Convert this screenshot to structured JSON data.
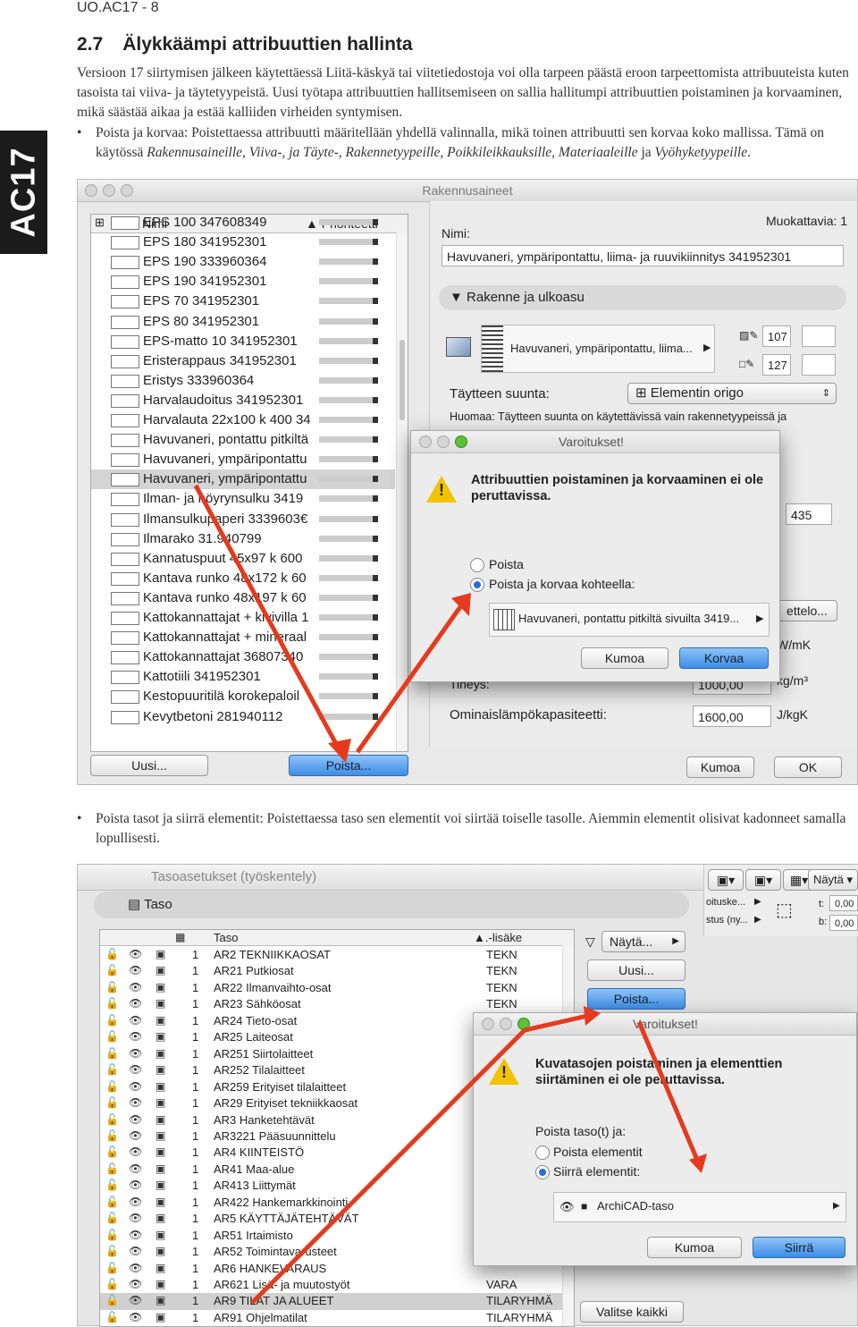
{
  "header": {
    "page_code": "UO.AC17 - 8"
  },
  "side_tab": {
    "label": "AC17"
  },
  "section": {
    "number": "2.7",
    "title": "Älykkäämpi attribuuttien hallinta"
  },
  "intro": "Versioon 17 siirtymisen jälkeen käytettäessä Liitä-käskyä tai viitetiedostoja voi olla tarpeen päästä eroon tarpeettomista attribuuteista kuten tasoista tai viiva- ja täytetyypeistä. Uusi työtapa attribuuttien hallitsemiseen on sallia hallitumpi attribuuttien poistaminen ja korvaaminen, mikä säästää aikaa ja estää kalliiden virheiden syntymisen.",
  "bullet1": {
    "lead": "Poista ja korvaa: Poistettaessa attribuutti määritellään yhdellä valinnalla, mikä toinen attribuutti sen korvaa koko mallissa. Tämä on käytössä ",
    "items": "Rakennusaineille, Viiva-, ja Täyte-, Rakennetyypeille, Poikkileikkauksille, Materiaaleille",
    "conj": " ja ",
    "last": "Vyöhyketyypeille",
    "end": "."
  },
  "bullet2": "Poista tasot ja siirrä elementit: Poistettaessa taso sen elementit voi siirtää toiselle tasolle. Aiemmin elementit olisivat kadonneet samalla lopullisesti.",
  "shot1": {
    "title": "Rakennusaineet",
    "col_name": "Nimi",
    "col_priority": "Prioriteetti",
    "items": [
      "EPS 100 347608349",
      "EPS 180 341952301",
      "EPS 190 333960364",
      "EPS 190 341952301",
      "EPS 70 341952301",
      "EPS 80 341952301",
      "EPS-matto 10 341952301",
      "Eristerappaus 341952301",
      "Eristys 333960364",
      "Harvalaudoitus 341952301",
      "Harvalauta 22x100 k 400 34",
      "Havuvaneri, pontattu pitkiltä",
      "Havuvaneri, ympäripontattu",
      "Havuvaneri, ympäripontattu",
      "Ilman- ja höyrynsulku 3419",
      "Ilmansulkupaperi 3339603€",
      "Ilmarako 31.940799",
      "Kannatuspuut 45x97 k 600",
      "Kantava runko 48x172 k 60",
      "Kantava runko 48x197 k 60",
      "Kattokannattajat + kivivilla 1",
      "Kattokannattajat + mineraal",
      "Kattokannattajat 36807340",
      "Kattotiili 341952301",
      "Kestopuuritilä korokepaloil",
      "Kevytbetoni 281940112"
    ],
    "new_button": "Uusi...",
    "delete_button": "Poista...",
    "editable": "Muokattavia: 1",
    "name_label": "Nimi:",
    "name_value": "Havuvaneri, ympäripontattu, liima- ja ruuvikiinnitys 341952301",
    "panel_structure": "Rakenne ja ulkoasu",
    "fill_name": "Havuvaneri, ympäripontattu, liima...",
    "pen1": "107",
    "pen2": "127",
    "fill_dir_label": "Täytteen suunta:",
    "fill_dir_value": "Elementin origo",
    "note": "Huomaa: Täytteen suunta on käytettävissä vain rakennetyypeissä ja",
    "val_435": "435",
    "btn_right": "ettelo...",
    "unit_wmk": "W/mK",
    "unit_kgm3": "kg/m³",
    "density_label": "Tiheys:",
    "density_value": "1000,00",
    "heat_label": "Ominaislämpökapasiteetti:",
    "heat_value": "1600,00",
    "unit_jkgk": "J/kgK",
    "cancel": "Kumoa",
    "ok": "OK",
    "dialog": {
      "title": "Varoitukset!",
      "message": "Attribuuttien poistaminen ja korvaaminen ei ole peruttavissa.",
      "opt1": "Poista",
      "opt2": "Poista ja korvaa kohteella:",
      "replace_value": "Havuvaneri, pontattu pitkiltä sivuilta 3419...",
      "cancel": "Kumoa",
      "confirm": "Korvaa"
    }
  },
  "shot2": {
    "title": "Tasoasetukset (työskentely)",
    "panel": "Taso",
    "col_layer": "Taso",
    "col_ext": ".-lisäke",
    "show_btn": "Näytä...",
    "new_btn": "Uusi...",
    "delete_btn": "Poista...",
    "select_all": "Valitse kaikki",
    "top_show": "Näytä",
    "right_lbl1": "oituske...",
    "right_lbl2": "stus (ny...",
    "t_label": "t:",
    "b_label": "b:",
    "t_value": "0,00",
    "b_value": "0,00",
    "rows": [
      {
        "n": "1",
        "name": "AR2 TEKNIIKKAOSAT",
        "ext": "TEKN"
      },
      {
        "n": "1",
        "name": "AR21 Putkiosat",
        "ext": "TEKN"
      },
      {
        "n": "1",
        "name": "AR22 Ilmanvaihto-osat",
        "ext": "TEKN"
      },
      {
        "n": "1",
        "name": "AR23 Sähköosat",
        "ext": "TEKN"
      },
      {
        "n": "1",
        "name": "AR24 Tieto-osat",
        "ext": ""
      },
      {
        "n": "1",
        "name": "AR25 Laiteosat",
        "ext": ""
      },
      {
        "n": "1",
        "name": "AR251 Siirtolaitteet",
        "ext": ""
      },
      {
        "n": "1",
        "name": "AR252 Tilalaitteet",
        "ext": ""
      },
      {
        "n": "1",
        "name": "AR259 Erityiset tilalaitteet",
        "ext": ""
      },
      {
        "n": "1",
        "name": "AR29 Erityiset tekniikkaosat",
        "ext": ""
      },
      {
        "n": "1",
        "name": "AR3 Hanketehtävät",
        "ext": ""
      },
      {
        "n": "1",
        "name": "AR3221 Pääsuunnittelu",
        "ext": ""
      },
      {
        "n": "1",
        "name": "AR4 KIINTEISTÖ",
        "ext": ""
      },
      {
        "n": "1",
        "name": "AR41 Maa-alue",
        "ext": ""
      },
      {
        "n": "1",
        "name": "AR413 Liittymät",
        "ext": ""
      },
      {
        "n": "1",
        "name": "AR422 Hankemarkkinointi",
        "ext": ""
      },
      {
        "n": "1",
        "name": "AR5 KÄYTTÄJÄTEHTÄVÄT",
        "ext": ""
      },
      {
        "n": "1",
        "name": "AR51 Irtaimisto",
        "ext": ""
      },
      {
        "n": "1",
        "name": "AR52 Toimintavarusteet",
        "ext": ""
      },
      {
        "n": "1",
        "name": "AR6 HANKEVARAUS",
        "ext": ""
      },
      {
        "n": "1",
        "name": "AR621 Lisä- ja muutostyöt",
        "ext": "VARA"
      },
      {
        "n": "1",
        "name": "AR9 TILAT JA ALUEET",
        "ext": "TILARYHMÄ"
      },
      {
        "n": "1",
        "name": "AR91 Ohjelmatilat",
        "ext": "TILARYHMÄ"
      }
    ],
    "dialog": {
      "title": "Varoitukset!",
      "message": "Kuvatasojen poistaminen ja elementtien siirtäminen ei ole peruttavissa.",
      "prompt": "Poista taso(t) ja:",
      "opt1": "Poista elementit",
      "opt2": "Siirrä elementit:",
      "target": "ArchiCAD-taso",
      "cancel": "Kumoa",
      "confirm": "Siirrä"
    }
  }
}
